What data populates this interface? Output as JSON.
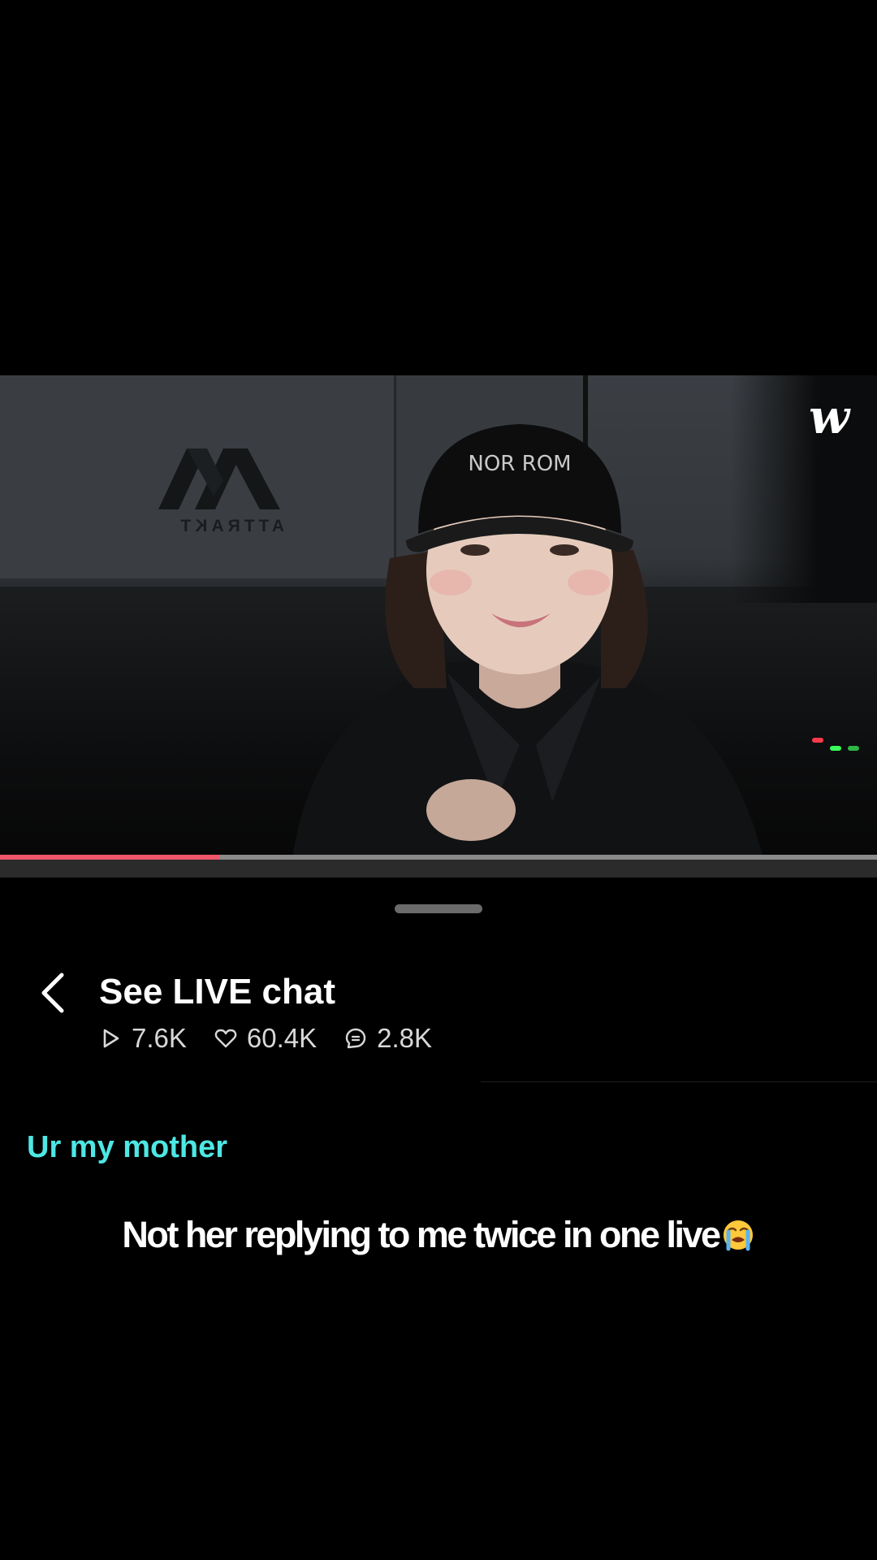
{
  "video": {
    "brand_logo": "w",
    "wall_sign": "ATTRAKT",
    "cap_text": "NOR ROM",
    "progress_fraction": 0.25,
    "progress_color": "#f0556a"
  },
  "chat_panel": {
    "back_icon": "chevron-left-icon",
    "title": "See LIVE chat",
    "stats": [
      {
        "icon": "play-icon",
        "value": "7.6K"
      },
      {
        "icon": "heart-icon",
        "value": "60.4K"
      },
      {
        "icon": "comment-icon",
        "value": "2.8K"
      }
    ],
    "highlighted_comment": "Ur my mother",
    "highlight_color": "#4ee7e4"
  },
  "caption": {
    "text": "Not her replying to me twice in one live",
    "emoji": "loudly-crying-face-emoji"
  }
}
